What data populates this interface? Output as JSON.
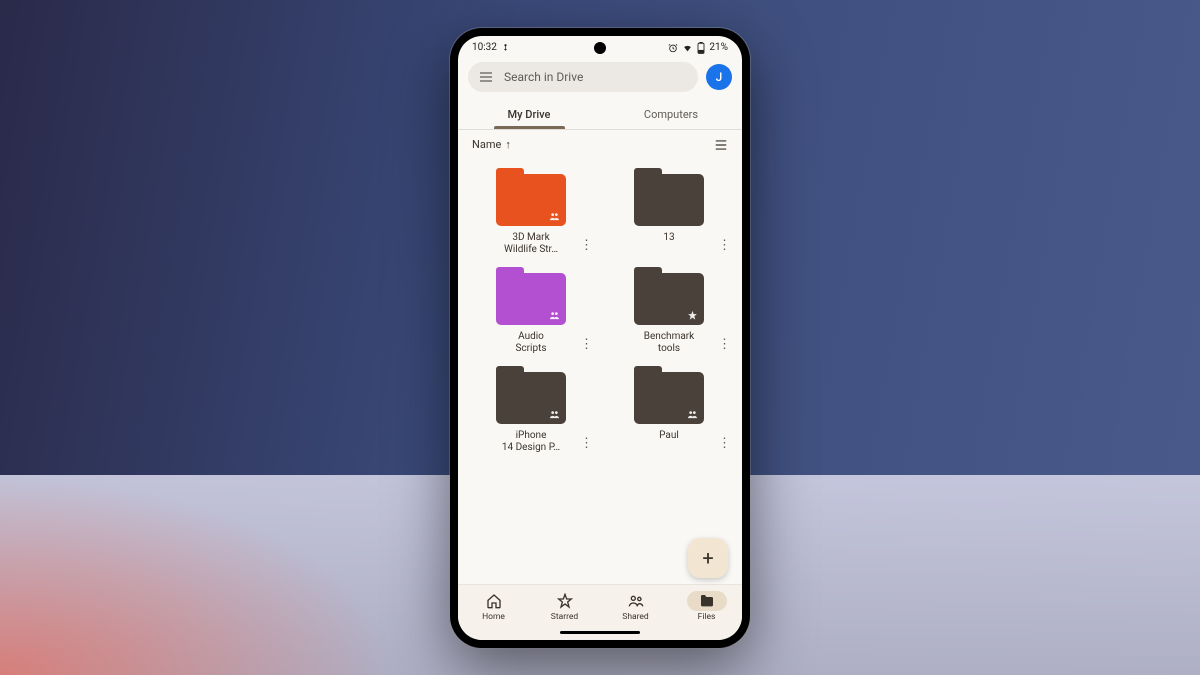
{
  "status": {
    "time": "10:32",
    "battery": "21%"
  },
  "search": {
    "placeholder": "Search in Drive"
  },
  "avatar": {
    "initial": "J"
  },
  "tabs": [
    {
      "label": "My Drive",
      "active": true
    },
    {
      "label": "Computers",
      "active": false
    }
  ],
  "sort": {
    "label": "Name"
  },
  "folders": [
    {
      "name": "3D Mark\nWildlife Str…",
      "color": "#e8521f",
      "badge": "shared"
    },
    {
      "name": "13",
      "color": "#4a423a",
      "badge": ""
    },
    {
      "name": "Audio\nScripts",
      "color": "#b34fd1",
      "badge": "shared"
    },
    {
      "name": "Benchmark\ntools",
      "color": "#4a423a",
      "badge": "star"
    },
    {
      "name": "iPhone\n14 Design P…",
      "color": "#4a423a",
      "badge": "shared"
    },
    {
      "name": "Paul",
      "color": "#4a423a",
      "badge": "shared"
    }
  ],
  "nav": [
    {
      "label": "Home",
      "icon": "home"
    },
    {
      "label": "Starred",
      "icon": "star"
    },
    {
      "label": "Shared",
      "icon": "people"
    },
    {
      "label": "Files",
      "icon": "folder",
      "active": true
    }
  ]
}
